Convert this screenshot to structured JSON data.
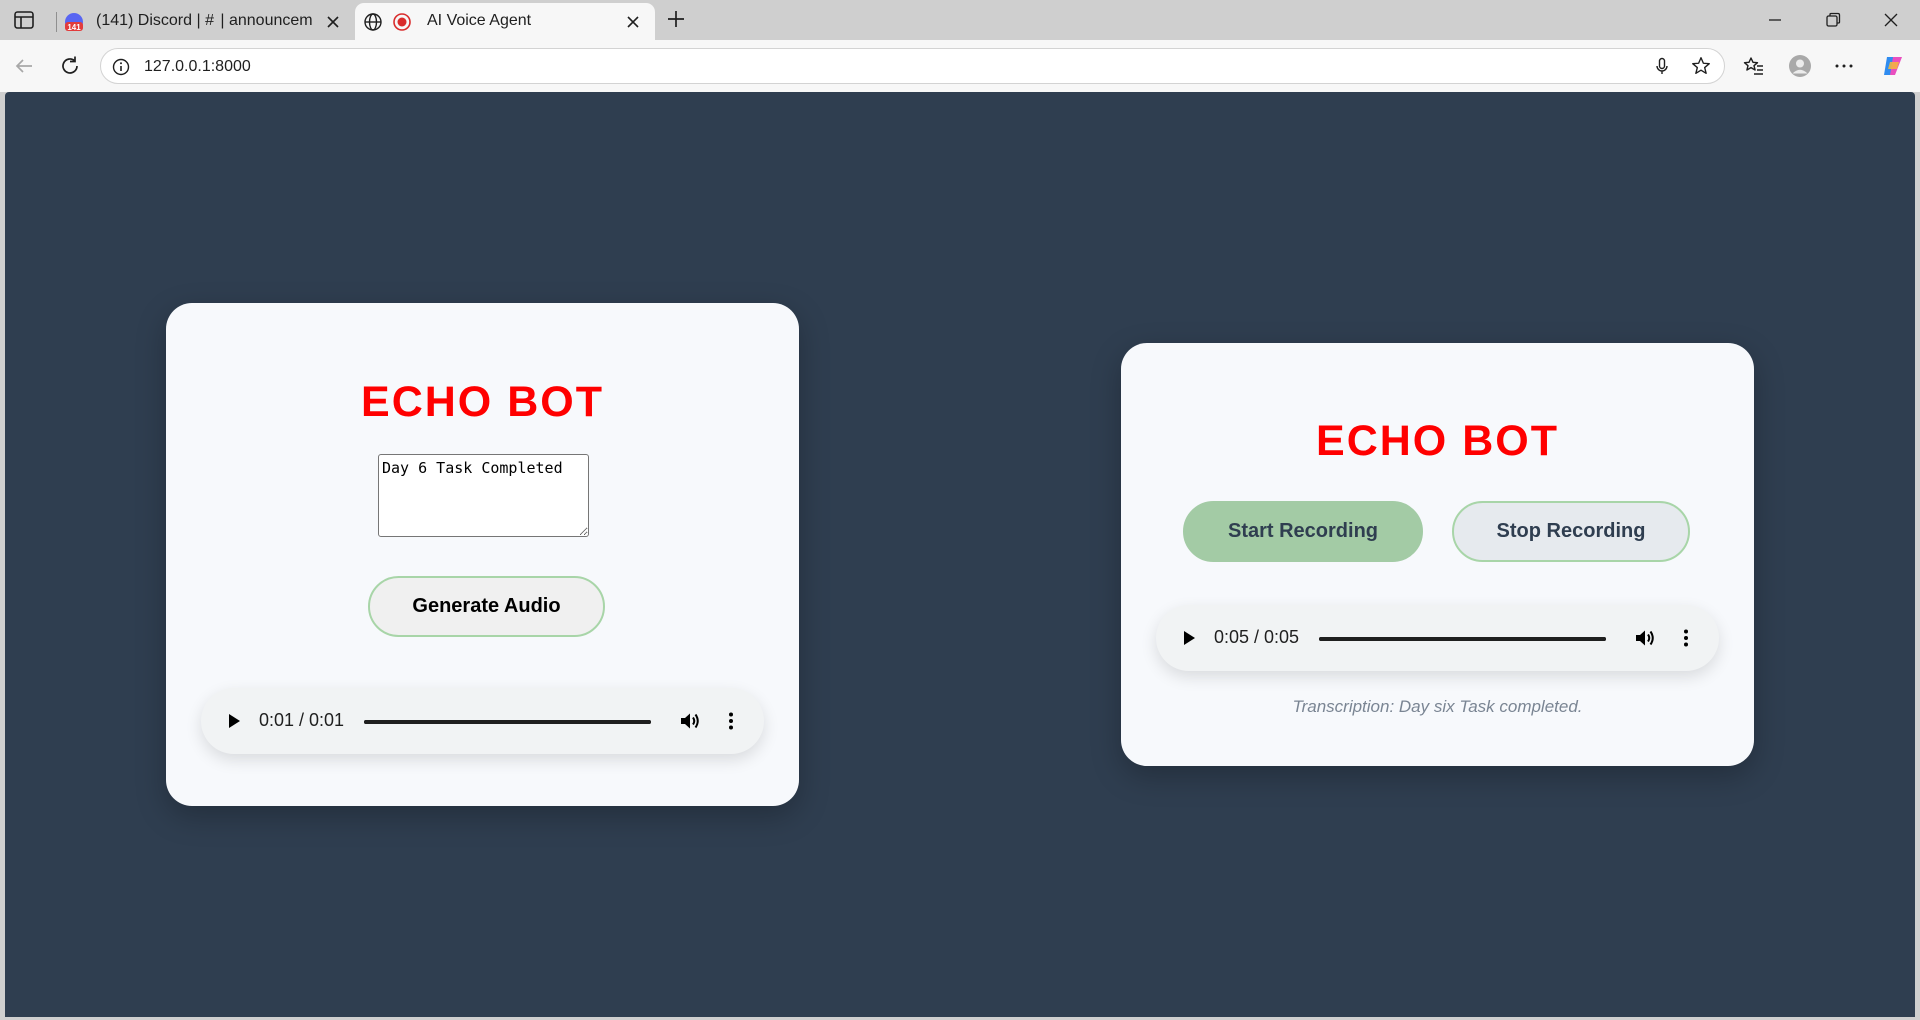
{
  "browser": {
    "tabs": [
      {
        "title": "(141) Discord | #  | announcem",
        "badge": "141",
        "active": false
      },
      {
        "title": "AI Voice Agent",
        "active": true
      }
    ],
    "url": "127.0.0.1:8000",
    "icons": {
      "sidebar": "sidebar-toggle-icon",
      "back": "back-arrow-icon",
      "reload": "reload-icon",
      "info": "info-icon",
      "mic": "microphone-icon",
      "favorite": "star-icon",
      "favorites": "favorites-list-icon",
      "profile": "profile-avatar-icon",
      "menu": "more-horizontal-icon",
      "copilot": "copilot-icon"
    }
  },
  "colors": {
    "page_bg": "#2f3e50",
    "card_bg": "#f7f9fc",
    "title_red": "#ff0000",
    "start_green": "#a3cba5",
    "border_green": "#a8d5a8"
  },
  "left_card": {
    "title": "ECHO BOT",
    "text_input_value": "Day 6 Task Completed",
    "generate_button": "Generate Audio",
    "player": {
      "time": "0:01 / 0:01",
      "progress": 1.0
    }
  },
  "right_card": {
    "title": "ECHO BOT",
    "start_button": "Start Recording",
    "stop_button": "Stop Recording",
    "player": {
      "time": "0:05 / 0:05",
      "progress": 1.0
    },
    "transcription": "Transcription: Day six Task completed."
  }
}
